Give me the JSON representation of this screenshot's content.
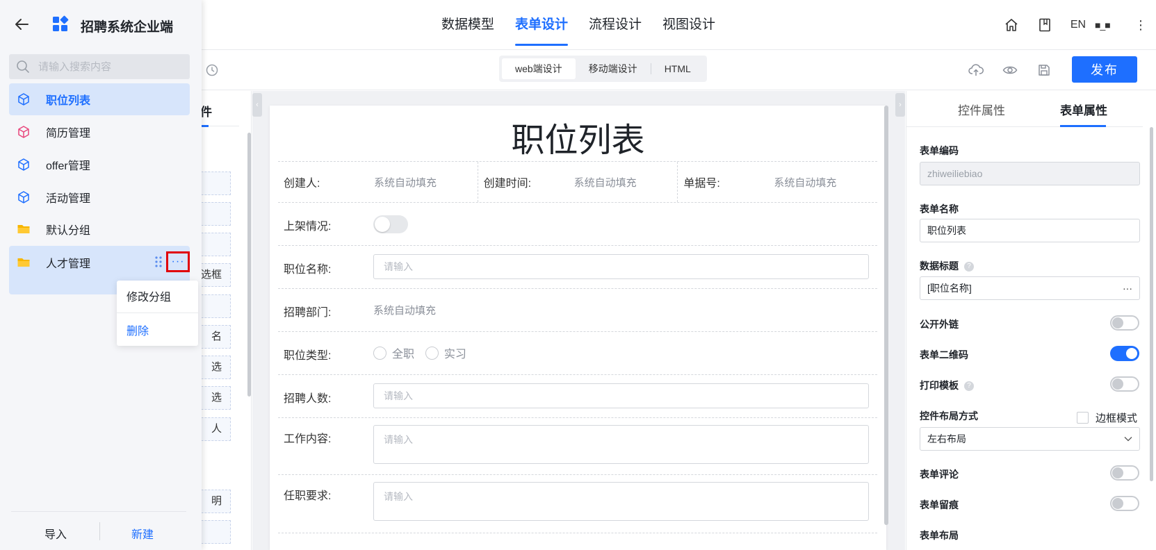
{
  "topbar": {
    "tabs": [
      {
        "label": "数据模型",
        "active": false
      },
      {
        "label": "表单设计",
        "active": true
      },
      {
        "label": "流程设计",
        "active": false
      },
      {
        "label": "视图设计",
        "active": false
      }
    ],
    "lang": "EN",
    "user_name": "■_■",
    "more": "⋮",
    "icons": [
      "home-icon",
      "book-icon"
    ]
  },
  "toolbar": {
    "segments": [
      "web端设计",
      "移动端设计",
      "HTML"
    ],
    "active_segment": "web端设计",
    "publish_label": "发布",
    "icons": [
      "history-icon",
      "cloud-upload-icon",
      "preview-eye-icon",
      "save-icon"
    ]
  },
  "component_panel": {
    "tab_text": "件",
    "items": [
      "",
      "",
      "",
      "选框",
      "",
      "名",
      "选",
      "选",
      "人",
      "明",
      ""
    ]
  },
  "form": {
    "title": "职位列表",
    "info": [
      {
        "label": "创建人:",
        "value": "系统自动填充"
      },
      {
        "label": "创建时间:",
        "value": "系统自动填充"
      },
      {
        "label": "单据号:",
        "value": "系统自动填充"
      }
    ],
    "fields": {
      "listing_status": {
        "label": "上架情况:"
      },
      "position_name": {
        "label": "职位名称:",
        "placeholder": "请输入"
      },
      "department": {
        "label": "招聘部门:",
        "value": "系统自动填充"
      },
      "position_type": {
        "label": "职位类型:",
        "options": [
          "全职",
          "实习"
        ]
      },
      "headcount": {
        "label": "招聘人数:",
        "placeholder": "请输入"
      },
      "job_content": {
        "label": "工作内容:",
        "placeholder": "请输入"
      },
      "requirements": {
        "label": "任职要求:",
        "placeholder": "请输入"
      }
    }
  },
  "properties": {
    "tabs": [
      "控件属性",
      "表单属性"
    ],
    "active_tab": "表单属性",
    "form_code": {
      "label": "表单编码",
      "value": "zhiweiliebiao"
    },
    "form_name": {
      "label": "表单名称",
      "value": "职位列表"
    },
    "data_title": {
      "label": "数据标题",
      "value": "[职位名称]",
      "more": "···"
    },
    "public_link": {
      "label": "公开外链",
      "on": false
    },
    "qr_code": {
      "label": "表单二维码",
      "on": true
    },
    "print_template": {
      "label": "打印模板",
      "on": false
    },
    "layout_mode": {
      "label": "控件布局方式",
      "border_mode_label": "边框模式",
      "value": "左右布局"
    },
    "comments": {
      "label": "表单评论",
      "on": false
    },
    "trace": {
      "label": "表单留痕",
      "on": false
    },
    "form_layout": {
      "label": "表单布局"
    },
    "help_mark": "?"
  },
  "drawer": {
    "app_title": "招聘系统企业端",
    "search_placeholder": "请输入搜索内容",
    "items": [
      {
        "label": "职位列表",
        "icon": "cube-icon",
        "color": "#1e6fff",
        "active": true
      },
      {
        "label": "简历管理",
        "icon": "cube-icon",
        "color": "#e8467c",
        "active": false
      },
      {
        "label": "offer管理",
        "icon": "cube-icon",
        "color": "#1e6fff",
        "active": false
      },
      {
        "label": "活动管理",
        "icon": "cube-icon",
        "color": "#1e6fff",
        "active": false
      },
      {
        "label": "默认分组",
        "icon": "folder-icon",
        "color": "#f7b500",
        "active": false
      },
      {
        "label": "人才管理",
        "icon": "folder-icon",
        "color": "#f7b500",
        "active": false
      }
    ],
    "more_label": "···",
    "context_menu": {
      "edit": "修改分组",
      "delete": "删除"
    },
    "import_label": "导入",
    "new_label": "新建"
  },
  "colors": {
    "accent": "#1e6fff",
    "highlight": "#e0000a",
    "folder": "#f7b500"
  }
}
